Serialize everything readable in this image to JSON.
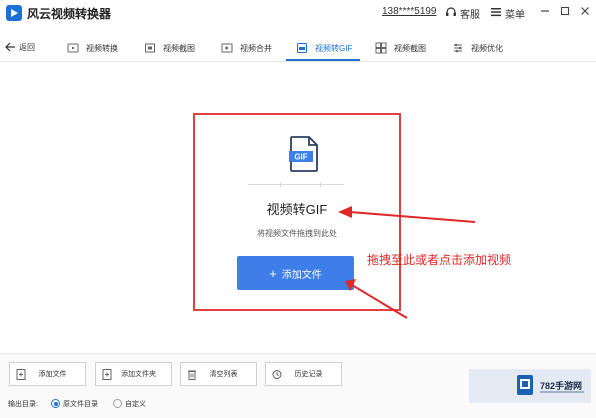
{
  "titlebar": {
    "app_title": "风云视频转换器",
    "phone": "138****5199",
    "service_label": "客服",
    "menu_label": "菜单"
  },
  "nav": {
    "back_label": "返回",
    "active_tab": "视频转GIF",
    "tabs": [
      {
        "label": "视频转换",
        "icon": "convert-icon"
      },
      {
        "label": "视频截图",
        "icon": "screenshot-icon"
      },
      {
        "label": "视频合并",
        "icon": "merge-icon"
      },
      {
        "label": "视频转GIF",
        "icon": "gif-icon"
      },
      {
        "label": "视频截图",
        "icon": "crop-icon"
      },
      {
        "label": "视频优化",
        "icon": "optimize-icon"
      }
    ]
  },
  "dropzone": {
    "file_badge": "GIF",
    "title": "视频转GIF",
    "hint": "将视频文件拖拽到此处",
    "add_button": "添加文件"
  },
  "annotation": {
    "text": "拖拽至此或者点击添加视频",
    "color": "#e02828"
  },
  "toolbar": {
    "buttons": [
      "添加文件",
      "添加文件夹",
      "清空列表",
      "历史记录"
    ]
  },
  "output": {
    "label": "输出目录:",
    "options": [
      {
        "label": "原文件目录",
        "selected": true
      },
      {
        "label": "自定义",
        "selected": false
      }
    ]
  },
  "watermark": {
    "text": "782手游网"
  },
  "colors": {
    "accent": "#1f6fd6",
    "button": "#3d7ee9",
    "highlight_border": "#e24040"
  }
}
